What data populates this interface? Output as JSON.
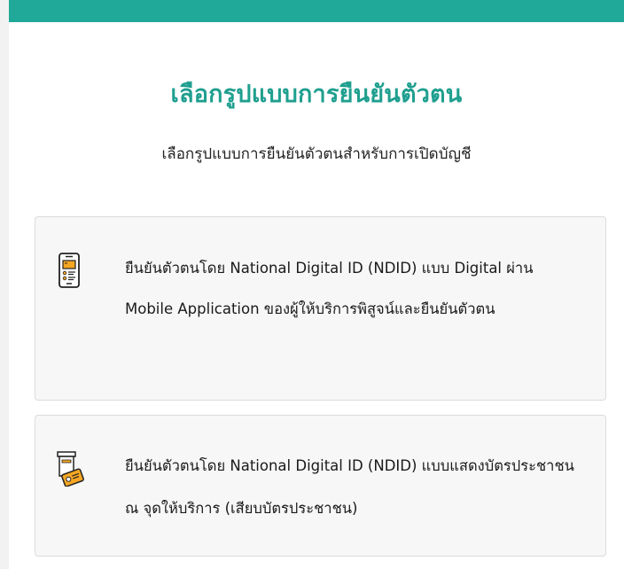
{
  "header": {
    "title": "เลือกรูปแบบการยืนยันตัวตน",
    "subtitle": "เลือกรูปแบบการยืนยันตัวตนสำหรับการเปิดบัญชี"
  },
  "options": [
    {
      "icon": "mobile-phone-icon",
      "text": "ยืนยันตัวตนโดย National Digital ID (NDID) แบบ Digital ผ่าน Mobile Application ของผู้ให้บริการพิสูจน์และยืนยันตัวตน"
    },
    {
      "icon": "id-card-reader-icon",
      "text": "ยืนยันตัวตนโดย National Digital ID (NDID) แบบแสดงบัตรประชาชน ณ จุดให้บริการ (เสียบบัตรประชาชน)"
    }
  ],
  "colors": {
    "accent": "#20a898",
    "title": "#1f9f8f",
    "icon_orange": "#f5a623"
  }
}
